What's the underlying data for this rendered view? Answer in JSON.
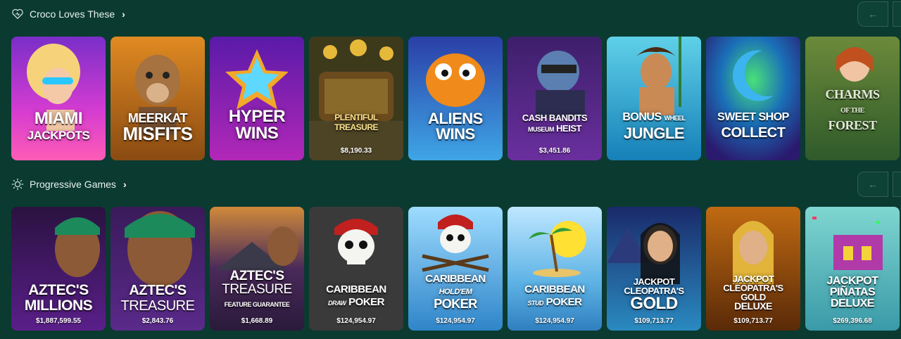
{
  "sections": [
    {
      "title": "Croco Loves These",
      "icon": "heart-icon",
      "games": [
        {
          "name": "MIAMI JACKPOTS",
          "jackpot": ""
        },
        {
          "name": "MEERKAT MISFITS",
          "jackpot": ""
        },
        {
          "name": "HYPER WINS",
          "jackpot": ""
        },
        {
          "name": "PLENTIFUL TREASURE",
          "jackpot": "$8,190.33"
        },
        {
          "name": "ALIENS WINS",
          "jackpot": ""
        },
        {
          "name": "CASH BANDITS MUSEUM HEIST",
          "jackpot": "$3,451.86"
        },
        {
          "name": "BONUS WHEEL JUNGLE",
          "jackpot": ""
        },
        {
          "name": "SWEET SHOP COLLECT",
          "jackpot": ""
        },
        {
          "name": "CHARMS OF THE FOREST",
          "jackpot": ""
        }
      ]
    },
    {
      "title": "Progressive Games",
      "icon": "sparkle-icon",
      "games": [
        {
          "name": "AZTEC'S MILLIONS",
          "jackpot": "$1,887,599.55"
        },
        {
          "name": "AZTEC'S TREASURE",
          "jackpot": "$2,843.76"
        },
        {
          "name": "AZTEC'S TREASURE FEATURE GUARANTEE",
          "jackpot": "$1,668.89"
        },
        {
          "name": "CARIBBEAN DRAW POKER",
          "jackpot": "$124,954.97"
        },
        {
          "name": "CARIBBEAN HOLD'EM POKER",
          "jackpot": "$124,954.97"
        },
        {
          "name": "CARIBBEAN STUD POKER",
          "jackpot": "$124,954.97"
        },
        {
          "name": "JACKPOT CLEOPATRA'S GOLD",
          "jackpot": "$109,713.77"
        },
        {
          "name": "JACKPOT CLEOPATRA'S GOLD DELUXE",
          "jackpot": "$109,713.77"
        },
        {
          "name": "JACKPOT PIÑATAS DELUXE",
          "jackpot": "$269,396.68"
        }
      ]
    }
  ],
  "nav": {
    "prev_icon": "arrow-left-icon",
    "next_icon": "arrow-right-icon"
  }
}
